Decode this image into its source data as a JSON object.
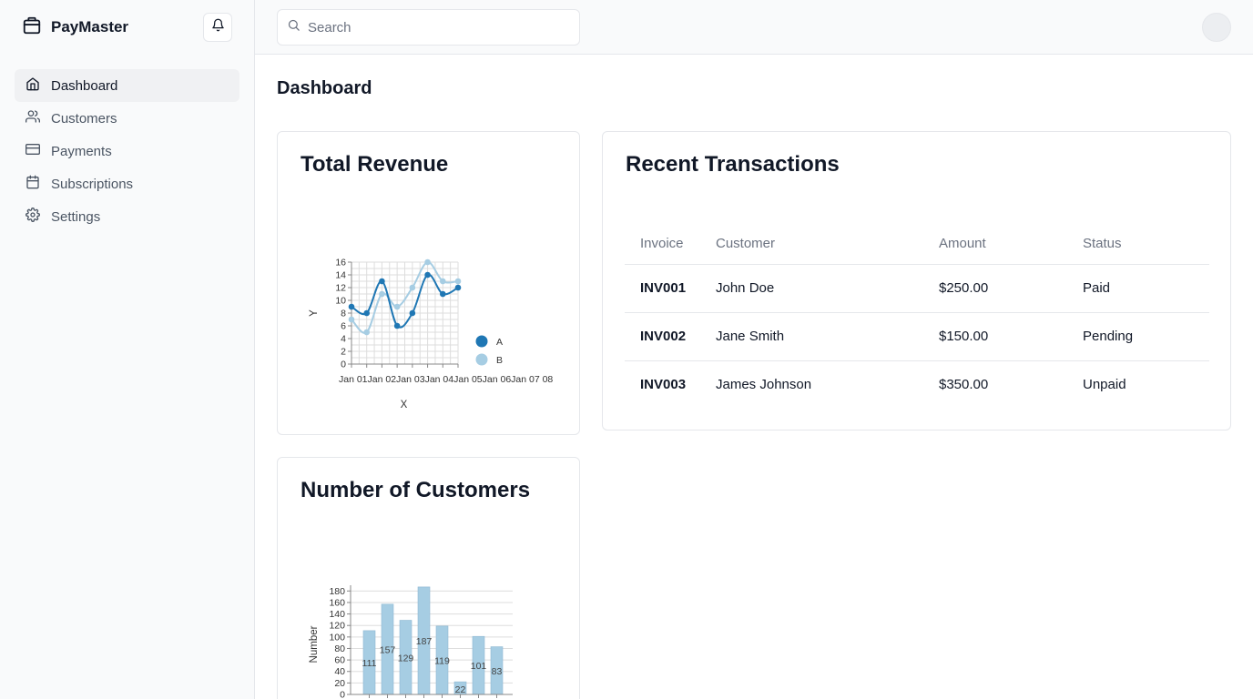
{
  "app": {
    "name": "PayMaster"
  },
  "sidebar": {
    "items": [
      {
        "label": "Dashboard",
        "icon": "home-icon",
        "active": true
      },
      {
        "label": "Customers",
        "icon": "users-icon",
        "active": false
      },
      {
        "label": "Payments",
        "icon": "credit-card-icon",
        "active": false
      },
      {
        "label": "Subscriptions",
        "icon": "calendar-icon",
        "active": false
      },
      {
        "label": "Settings",
        "icon": "gear-icon",
        "active": false
      }
    ]
  },
  "search": {
    "placeholder": "Search",
    "value": ""
  },
  "page": {
    "title": "Dashboard"
  },
  "revenue": {
    "title": "Total Revenue"
  },
  "transactions": {
    "title": "Recent Transactions",
    "columns": [
      "Invoice",
      "Customer",
      "Amount",
      "Status"
    ],
    "rows": [
      {
        "invoice": "INV001",
        "customer": "John Doe",
        "amount": "$250.00",
        "status": "Paid"
      },
      {
        "invoice": "INV002",
        "customer": "Jane Smith",
        "amount": "$150.00",
        "status": "Pending"
      },
      {
        "invoice": "INV003",
        "customer": "James Johnson",
        "amount": "$350.00",
        "status": "Unpaid"
      }
    ]
  },
  "customers": {
    "title": "Number of Customers"
  },
  "colors": {
    "accent_dark": "#1f77b4",
    "accent_light": "#a6cde3",
    "border": "#e5e7eb"
  },
  "chart_data": [
    {
      "type": "line",
      "xlabel": "X",
      "ylabel": "Y",
      "ylim": [
        0,
        16
      ],
      "yticks": [
        0,
        2,
        4,
        6,
        8,
        10,
        12,
        14,
        16
      ],
      "x": [
        "Jan 01",
        "Jan 02",
        "Jan 03",
        "Jan 04",
        "Jan 05",
        "Jan 06",
        "Jan 07",
        "Jan 08"
      ],
      "xtick_text": "Jan 01Jan 02Jan 03Jan 04Jan 05Jan 06Jan 07 08",
      "series": [
        {
          "name": "A",
          "color": "#1f77b4",
          "values": [
            9,
            8,
            13,
            6,
            8,
            14,
            11,
            12
          ]
        },
        {
          "name": "B",
          "color": "#a6cde3",
          "values": [
            7,
            5,
            11,
            9,
            12,
            16,
            13,
            13
          ]
        }
      ],
      "grid": true,
      "legend": "right"
    },
    {
      "type": "bar",
      "ylabel": "Number",
      "ylim": [
        0,
        190
      ],
      "yticks": [
        0,
        20,
        40,
        60,
        80,
        100,
        120,
        140,
        160,
        180
      ],
      "values": [
        111,
        157,
        129,
        187,
        119,
        22,
        101,
        83
      ],
      "bar_color": "#a6cde3",
      "data_labels": true,
      "grid": true
    }
  ]
}
